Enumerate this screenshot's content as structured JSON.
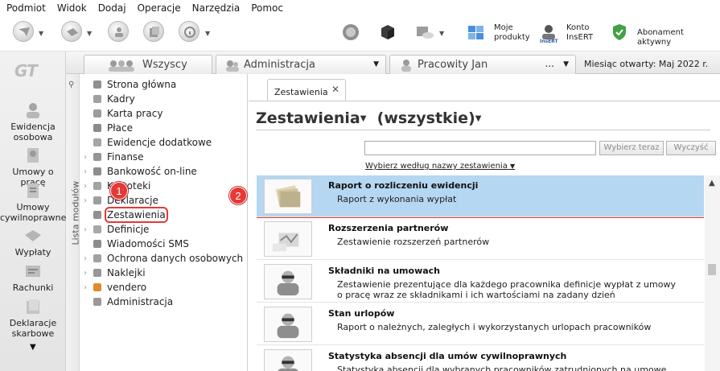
{
  "menubar": {
    "items": [
      "Podmiot",
      "Widok",
      "Dodaj",
      "Operacje",
      "Narzędzia",
      "Pomoc"
    ]
  },
  "toolbar": {
    "tiles": [
      {
        "label_line1": "Moje",
        "label_line2": "produkty",
        "icon": "products-icon"
      },
      {
        "label_line1": "Konto",
        "label_line2": "InsERT",
        "icon": "account-icon"
      },
      {
        "label_line1": "Abonament aktywny",
        "label_line2": "",
        "icon": "shield-icon"
      }
    ],
    "account_icon_text": "InsERT"
  },
  "rail": {
    "logo": "GT",
    "items": [
      {
        "line1": "Ewidencja",
        "line2": "osobowa"
      },
      {
        "line1": "Umowy o pracę",
        "line2": ""
      },
      {
        "line1": "Umowy",
        "line2": "cywilnoprawne"
      },
      {
        "line1": "Wypłaty",
        "line2": ""
      },
      {
        "line1": "Rachunki",
        "line2": ""
      },
      {
        "line1": "Deklaracje",
        "line2": "skarbowe"
      }
    ]
  },
  "context": {
    "tab1": "Wszyscy",
    "tab2": "Administracja",
    "tab3": "Pracowity Jan",
    "tab3_more": "...",
    "month": "Miesiąc otwarty:  Maj 2022 r."
  },
  "modules": {
    "strip_label": "Lista modułów",
    "items": [
      {
        "label": "Strona główna",
        "expandable": false
      },
      {
        "label": "Kadry",
        "expandable": false
      },
      {
        "label": "Karta pracy",
        "expandable": false
      },
      {
        "label": "Płace",
        "expandable": false
      },
      {
        "label": "Ewidencje dodatkowe",
        "expandable": false
      },
      {
        "label": "Finanse",
        "expandable": true
      },
      {
        "label": "Bankowość on-line",
        "expandable": true
      },
      {
        "label": "Kartoteki",
        "expandable": true
      },
      {
        "label": "Deklaracje",
        "expandable": true
      },
      {
        "label": "Zestawienia",
        "expandable": false,
        "selected": true
      },
      {
        "label": "Definicje",
        "expandable": true
      },
      {
        "label": "Wiadomości SMS",
        "expandable": false
      },
      {
        "label": "Ochrona danych osobowych",
        "expandable": true
      },
      {
        "label": "Naklejki",
        "expandable": true
      },
      {
        "label": "vendero",
        "expandable": true
      },
      {
        "label": "Administracja",
        "expandable": false
      }
    ]
  },
  "main": {
    "tab_label": "Zestawienia",
    "title_left": "Zestawienia",
    "title_right": "(wszystkie)",
    "search_value": "",
    "btn_choose": "Wybierz teraz",
    "btn_clear": "Wyczyść",
    "choose_by_name": "Wybierz według nazwy zestawienia",
    "reports": [
      {
        "title": "Raport o rozliczeniu ewidencji",
        "desc": "Raport z wykonania wypłat",
        "selected": true
      },
      {
        "title": "Rozszerzenia partnerów",
        "desc": "Zestawienie rozszerzeń partnerów"
      },
      {
        "title": "Składniki na umowach",
        "desc": "Zestawienie prezentujące dla każdego pracownika definicje wypłat z umowy o pracę wraz ze składnikami i ich wartościami na zadany dzień"
      },
      {
        "title": "Stan urlopów",
        "desc": "Raport o należnych, zaległych i wykorzystanych urlopach pracowników"
      },
      {
        "title": "Statystyka absencji dla umów cywilnoprawnych",
        "desc": "Statystyka absencji dla wybranych pracowników zatrudnionych na umowę"
      }
    ]
  },
  "callouts": [
    "1",
    "2"
  ],
  "colors": {
    "selection": "#b5d7f2",
    "callout": "#e53935"
  }
}
